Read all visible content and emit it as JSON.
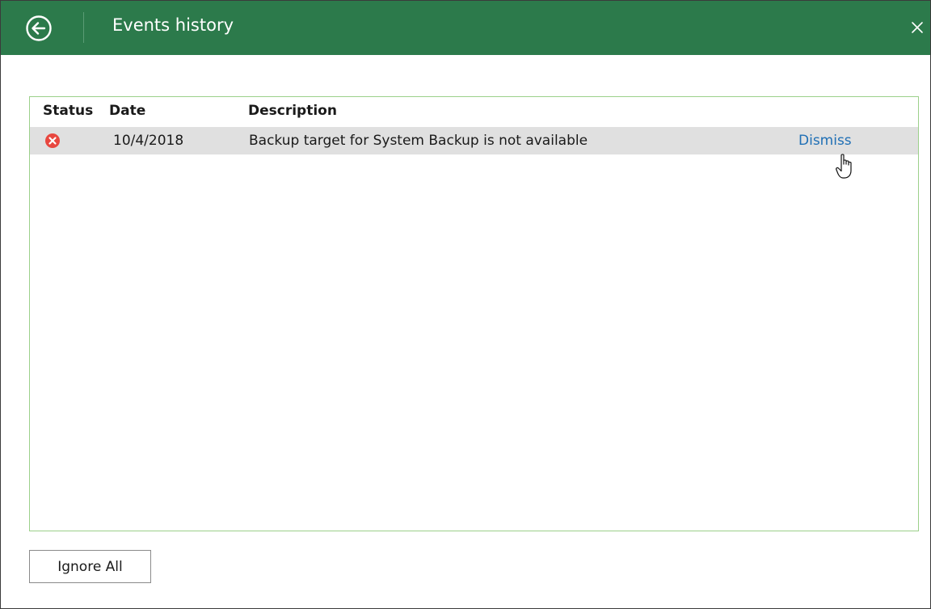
{
  "titlebar": {
    "title": "Events history",
    "back_icon": "back-arrow-icon",
    "close_icon": "close-icon",
    "color": "#2c7a4b"
  },
  "table": {
    "columns": [
      "Status",
      "Date",
      "Description"
    ],
    "rows": [
      {
        "status_icon": "error-icon",
        "status_color": "#e8473f",
        "date": "10/4/2018",
        "description": "Backup target for System Backup is not available",
        "action": "Dismiss"
      }
    ]
  },
  "footer": {
    "ignore_all_label": "Ignore All"
  },
  "colors": {
    "panel_border": "#9cd08a",
    "link": "#1f6fb5",
    "row_highlight": "#e0e0e0"
  }
}
